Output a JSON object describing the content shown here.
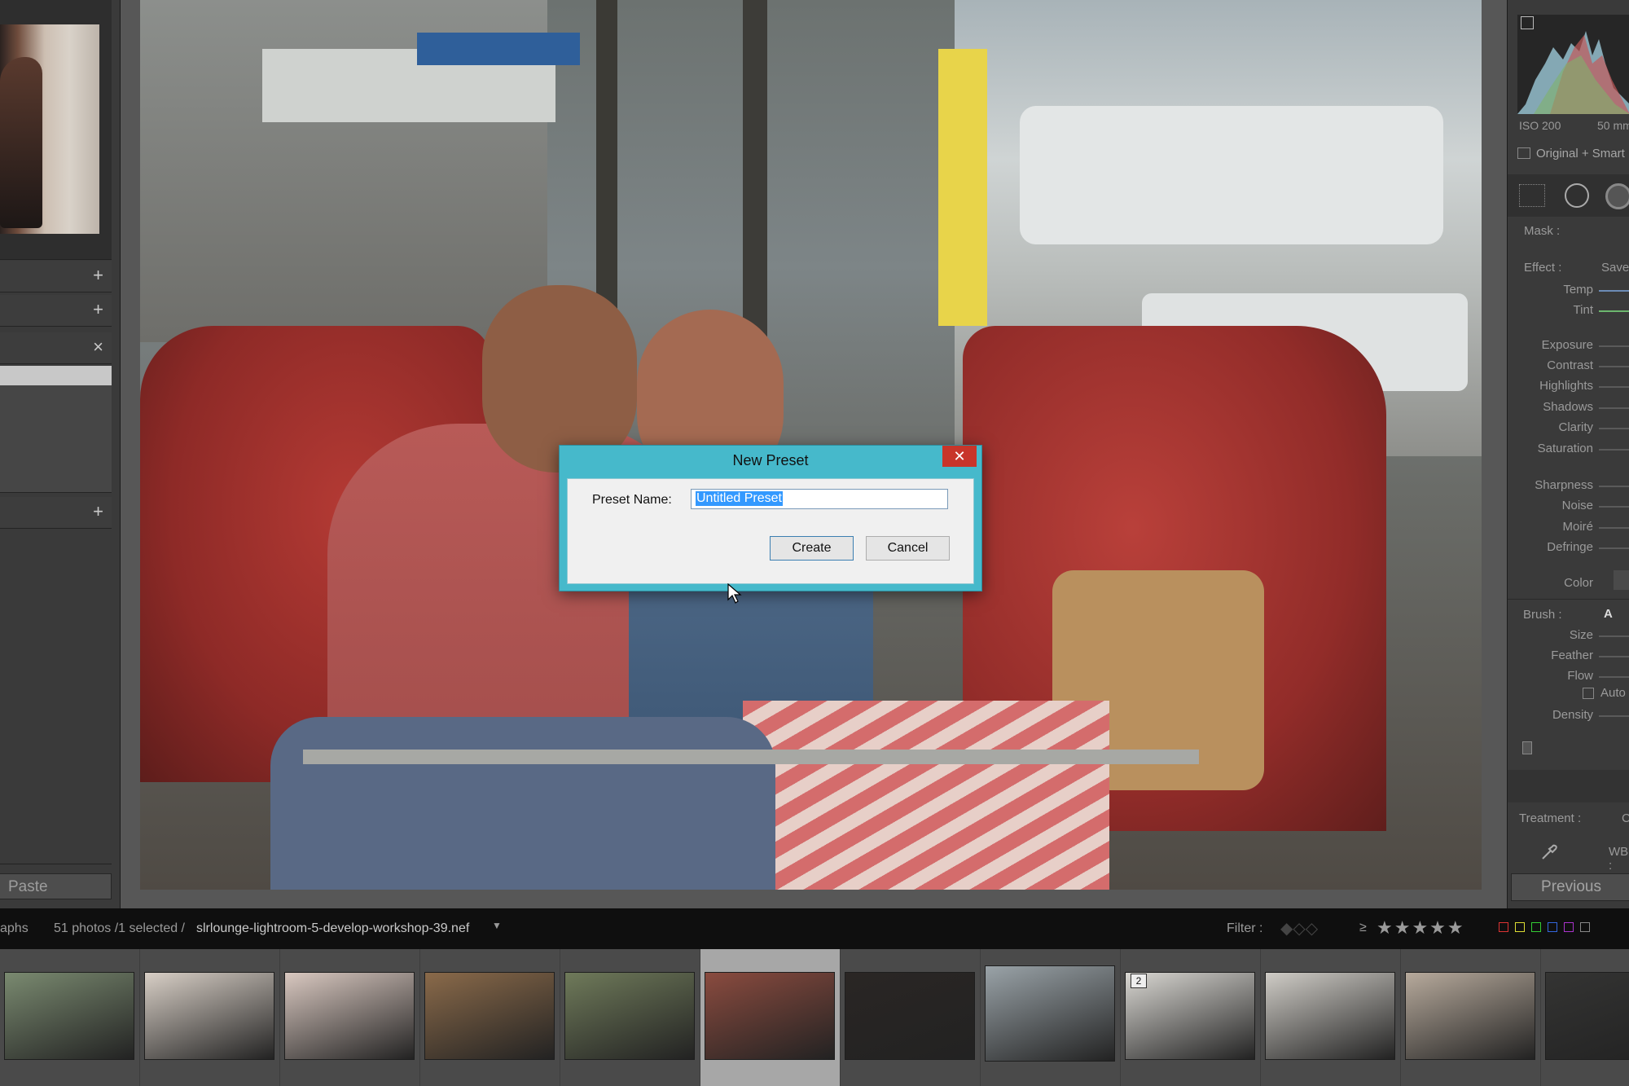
{
  "left_panel": {
    "paste_label": "Paste",
    "plus_icon": "+",
    "close_icon": "×"
  },
  "dialog": {
    "title": "New Preset",
    "close_glyph": "✕",
    "preset_name_label": "Preset Name:",
    "preset_name_value": "Untitled Preset",
    "create_label": "Create",
    "cancel_label": "Cancel"
  },
  "right_panel": {
    "iso": "ISO 200",
    "focal": "50 mm",
    "original_label": "Original + Smart",
    "mask_label": "Mask :",
    "effect_label": "Effect :",
    "effect_value": "Save",
    "sliders_group1": [
      "Temp",
      "Tint"
    ],
    "sliders_group2": [
      "Exposure",
      "Contrast",
      "Highlights",
      "Shadows",
      "Clarity",
      "Saturation"
    ],
    "sliders_group3": [
      "Sharpness",
      "Noise",
      "Moiré",
      "Defringe"
    ],
    "color_label": "Color",
    "brush_label": "Brush :",
    "brush_value": "A",
    "brush_sliders": [
      "Size",
      "Feather",
      "Flow"
    ],
    "auto_label": "Auto",
    "density_label": "Density",
    "treatment_label": "Treatment :",
    "treatment_value": "C",
    "wb_label": "WB :",
    "previous_label": "Previous"
  },
  "film_header": {
    "source_tail": "aphs",
    "count": "51 photos /1 selected /",
    "filename": "slrlounge-lightroom-5-develop-workshop-39.nef",
    "filter_label": "Filter :",
    "rating_op": "≥",
    "stars": "★★★★★"
  },
  "filmstrip": {
    "badge": "2",
    "selected_index": 5,
    "thumb_colors": [
      "#7a8a70",
      "#d8cfc6",
      "#d9c8c0",
      "#8a6a4a",
      "#6f7a5a",
      "#8a4b3f",
      "#2a2624",
      "#9aa3a8",
      "#d9d7d2",
      "#cfccc6",
      "#b7aa9c",
      "#343433"
    ]
  },
  "colors": {
    "dialog_frame": "#46b9cb",
    "dialog_close": "#c8352a",
    "selection": "#3399ff",
    "panel": "#3a3a3a"
  }
}
